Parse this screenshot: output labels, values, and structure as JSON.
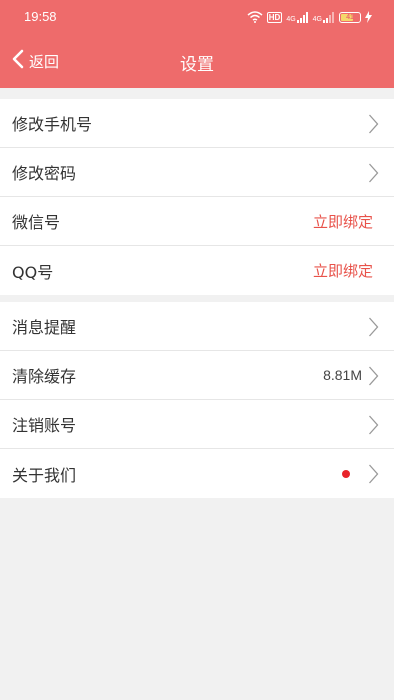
{
  "status_bar": {
    "time": "19:58",
    "hd_label": "HD",
    "sig1_label": "4G",
    "sig2_label": "4G",
    "battery_level": "41"
  },
  "header": {
    "back_label": "返回",
    "title": "设置"
  },
  "group1": [
    {
      "label": "修改手机号"
    },
    {
      "label": "修改密码"
    },
    {
      "label": "微信号",
      "action": "立即绑定"
    },
    {
      "label": "QQ号",
      "action": "立即绑定"
    }
  ],
  "group2": [
    {
      "label": "消息提醒"
    },
    {
      "label": "清除缓存",
      "value": "8.81M"
    },
    {
      "label": "注销账号"
    },
    {
      "label": "关于我们",
      "has_notification_dot": true
    }
  ],
  "colors": {
    "header_bg": "#ee6b6b",
    "action_text": "#e8524a",
    "notification_dot": "#e8242a",
    "page_bg": "#f1f1f1"
  }
}
